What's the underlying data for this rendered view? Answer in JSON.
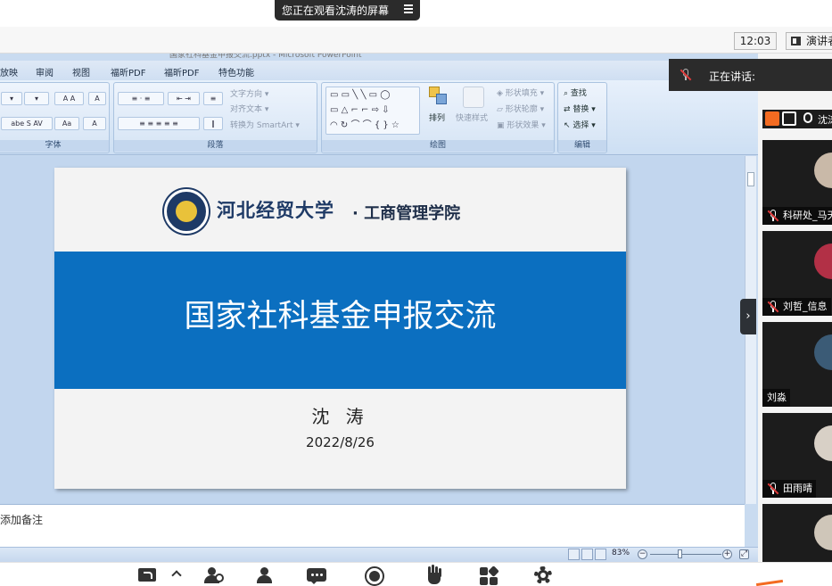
{
  "share_banner": {
    "text": "您正在观看沈涛的屏幕",
    "menu_icon": "menu-icon"
  },
  "meeting_bar": {
    "clock": "12:03",
    "view_button": "演讲者视图"
  },
  "powerpoint": {
    "window_title": "国家社科基金申报交流.pptx - Microsoft PowerPoint",
    "tabs": [
      "放映",
      "审阅",
      "视图",
      "福昕PDF",
      "福昕PDF",
      "特色功能"
    ],
    "groups": {
      "font": "字体",
      "paragraph": "段落",
      "drawing": "绘图",
      "editing": "编辑"
    },
    "ribbon_items": {
      "text_direction": "文字方向",
      "align_text": "对齐文本",
      "convert_smartart": "转换为 SmartArt",
      "arrange": "排列",
      "quick_styles": "快速样式",
      "shape_fill": "形状填充",
      "shape_outline": "形状轮廓",
      "shape_effects": "形状效果",
      "find": "查找",
      "replace": "替换",
      "select": "选择"
    },
    "slide": {
      "school": "河北经贸大学",
      "college": "· 工商管理学院",
      "title": "国家社科基金申报交流",
      "author": "沈 涛",
      "date": "2022/8/26"
    },
    "notes_placeholder": "添加备注",
    "zoom_level": "83%"
  },
  "speaking": {
    "label": "正在讲话:"
  },
  "participants": [
    {
      "name": "沈涛",
      "role": "self"
    },
    {
      "name": "科研处_马天",
      "muted": true,
      "avatar_color": "#c9b9a8"
    },
    {
      "name": "刘哲_信息",
      "muted": true,
      "avatar_color": "#b23046"
    },
    {
      "name": "刘淼",
      "muted": false,
      "avatar_color": "#3b5b76"
    },
    {
      "name": "田雨晴",
      "muted": true,
      "avatar_color": "#d8d0c6"
    }
  ],
  "toolbar": [
    {
      "name": "share-screen-icon"
    },
    {
      "name": "invite-icon"
    },
    {
      "name": "participants-icon"
    },
    {
      "name": "chat-icon"
    },
    {
      "name": "record-icon"
    },
    {
      "name": "raise-hand-icon"
    },
    {
      "name": "apps-icon"
    },
    {
      "name": "settings-icon"
    }
  ],
  "colors": {
    "slide_band": "#0b6fc0",
    "brand_navy": "#1e3a66",
    "banner_bg": "#2b2b2b",
    "self_tag": "#f36b21"
  }
}
